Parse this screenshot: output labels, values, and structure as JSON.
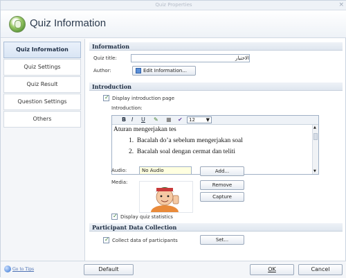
{
  "window": {
    "title": "Quiz Properties",
    "close_glyph": "×"
  },
  "header": {
    "title": "Quiz Information",
    "icon": "quiz-info-icon"
  },
  "sidebar": {
    "items": [
      {
        "label": "Quiz Information",
        "active": true
      },
      {
        "label": "Quiz Settings",
        "active": false
      },
      {
        "label": "Quiz Result",
        "active": false
      },
      {
        "label": "Question Settings",
        "active": false
      },
      {
        "label": "Others",
        "active": false
      }
    ]
  },
  "information": {
    "heading": "Information",
    "quiz_title_label": "Quiz title:",
    "quiz_title_value": "الاختيار",
    "author_label": "Author:",
    "edit_info_button": "Edit Information..."
  },
  "introduction": {
    "heading": "Introduction",
    "display_intro_label": "Display introduction page",
    "display_intro_checked": true,
    "intro_label": "Introduction:",
    "toolbar": {
      "bold": "B",
      "italic": "I",
      "underline": "U",
      "font_size": "12"
    },
    "text_heading": "Aturan mengerjakan tes",
    "list_items": [
      {
        "num": "1.",
        "text": "Bacalah do’a sebelum mengerjakan soal"
      },
      {
        "num": "2.",
        "text": "Bacalah soal dengan cermat dan teliti"
      }
    ],
    "audio_label": "Audio:",
    "audio_value": "No Audio",
    "add_button": "Add...",
    "media_label": "Media:",
    "remove_button": "Remove",
    "capture_button": "Capture",
    "display_stats_label": "Display quiz statistics",
    "display_stats_checked": true
  },
  "participant": {
    "heading": "Participant Data Collection",
    "collect_label": "Collect data of participants",
    "collect_checked": true,
    "set_button": "Set..."
  },
  "footer": {
    "goto_tips": "Go to Tips",
    "default_button": "Default",
    "ok_button": "OK",
    "cancel_button": "Cancel"
  },
  "colors": {
    "accent": "#2f6fd1",
    "section_bg": "#dfe6ef",
    "audio_bg": "#ffffe0"
  }
}
